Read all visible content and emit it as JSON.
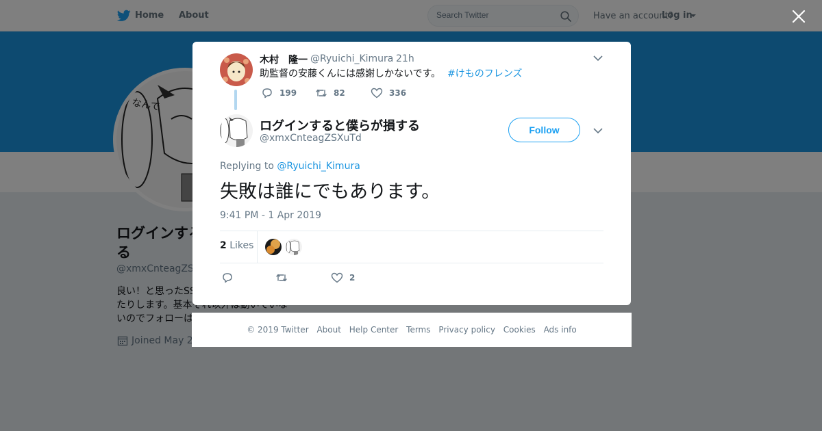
{
  "topbar": {
    "home_label": "Home",
    "about_label": "About",
    "search_placeholder": "Search Twitter",
    "have_account": "Have an account?",
    "login_label": "Log in"
  },
  "profile": {
    "name": "ログインすると僕らが損する",
    "handle": "@xmxCnteagZSXuTd",
    "bio": "良い！と思ったSSをRTしたりフォローしたりします。基本それ以外は動いていないのでフォローは不要です",
    "joined": "Joined May 2018"
  },
  "parent_tweet": {
    "name": "木村　隆一",
    "handle": "@Ryuichi_Kimura",
    "separator": "·",
    "time": "21h",
    "text": "助監督の安藤くんには感謝しかないです。",
    "hashtag": "#けものフレンズ",
    "reply_count": "199",
    "retweet_count": "82",
    "like_count": "336"
  },
  "tweet": {
    "name": "ログインすると僕らが損する",
    "handle": "@xmxCnteagZSXuTd",
    "follow_label": "Follow",
    "replying_prefix": "Replying to",
    "replying_to": "@Ryuichi_Kimura",
    "text": "失敗は誰にでもあります。",
    "timestamp": "9:41 PM - 1 Apr 2019",
    "likes_number": "2",
    "likes_label": "Likes",
    "like_count": "2"
  },
  "footer": {
    "links": [
      "© 2019 Twitter",
      "About",
      "Help Center",
      "Terms",
      "Privacy policy",
      "Cookies",
      "Ads info"
    ]
  },
  "colors": {
    "link_blue": "#1b95e0",
    "twitter_blue": "#1da1f2",
    "banner_blue": "#1b95e0",
    "secondary_text": "#657786",
    "primary_text": "#14171a"
  },
  "icons": [
    "twitter-bird-icon",
    "search-icon",
    "close-icon",
    "chevron-down-icon",
    "reply-icon",
    "retweet-icon",
    "heart-icon",
    "calendar-icon"
  ]
}
